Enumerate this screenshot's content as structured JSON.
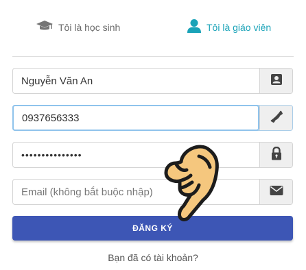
{
  "tabs": {
    "student": {
      "label": "Tôi là học sinh",
      "icon": "graduation-cap-icon",
      "color": "#6b6b6b"
    },
    "teacher": {
      "label": "Tôi là giáo viên",
      "icon": "user-icon",
      "color": "#1aa3b8",
      "active": true
    }
  },
  "form": {
    "name": {
      "value": "Nguyễn Văn An",
      "icon": "contact-card-icon"
    },
    "phone": {
      "value": "0937656333",
      "icon": "phone-icon"
    },
    "password": {
      "value": "•••••••••••••••",
      "icon": "lock-icon"
    },
    "email": {
      "value": "",
      "placeholder": "Email (không bắt buộc nhập)",
      "icon": "envelope-icon"
    },
    "submit_label": "ĐĂNG KÝ"
  },
  "login_link": "Bạn đã có tài khoản?",
  "colors": {
    "primary": "#3d56b5",
    "accent": "#1aa3b8",
    "hand": "#f5c77e"
  }
}
